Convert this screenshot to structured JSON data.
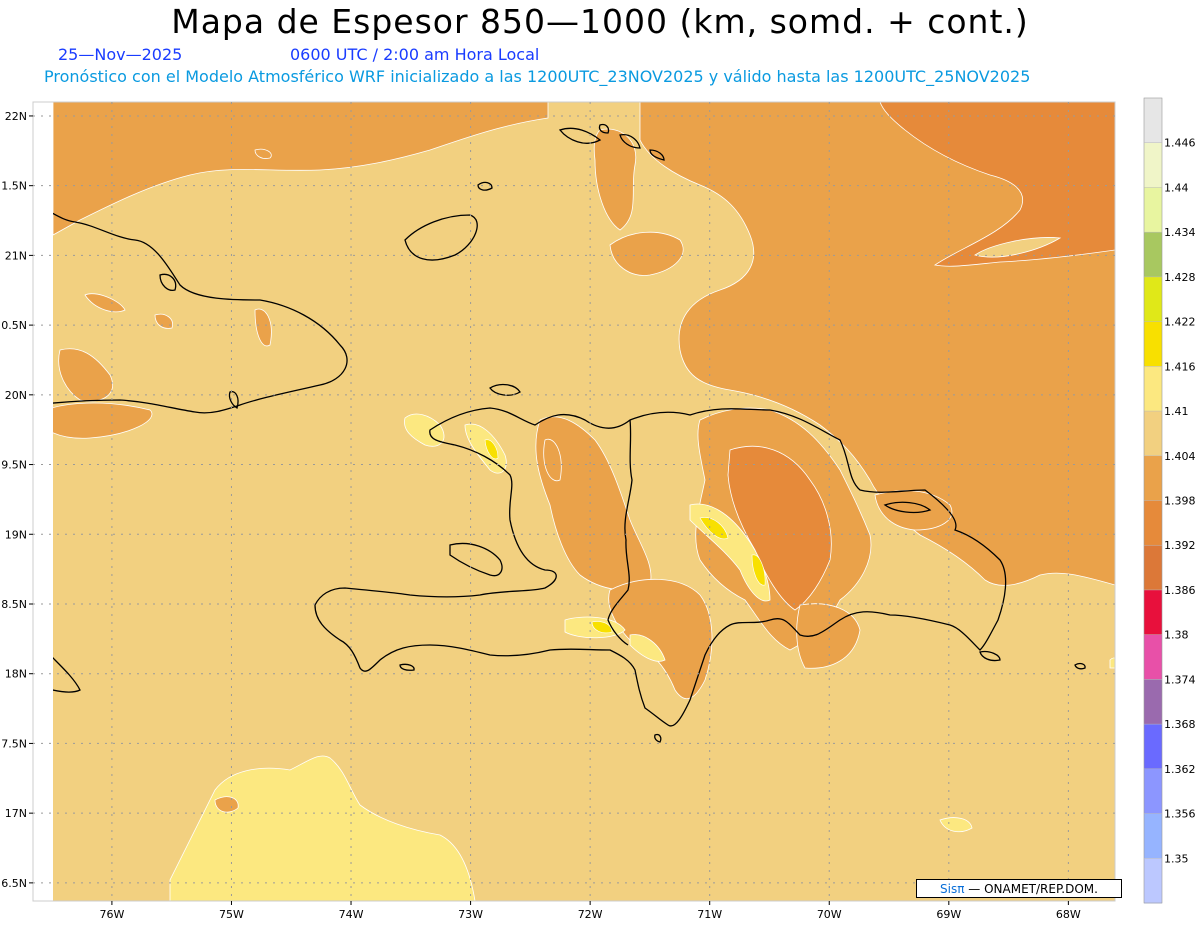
{
  "header": {
    "title": "Mapa de Espesor 850—1000 (km, somd. + cont.)",
    "date": "25—Nov—2025",
    "time": "0600 UTC / 2:00 am Hora Local",
    "model_line": "Pronóstico con el Modelo Atmosférico WRF inicializado a las 1200UTC_23NOV2025 y válido hasta las  1200UTC_25NOV2025"
  },
  "axes": {
    "lat_labels": [
      "22N",
      "1.5N",
      "21N",
      "0.5N",
      "20N",
      "9.5N",
      "19N",
      "8.5N",
      "18N",
      "7.5N",
      "17N",
      "6.5N"
    ],
    "lat_values": [
      22,
      21.5,
      21,
      20.5,
      20,
      19.5,
      19,
      18.5,
      18,
      17.5,
      17,
      16.5
    ],
    "lon_labels": [
      "76W",
      "75W",
      "74W",
      "73W",
      "72W",
      "71W",
      "70W",
      "69W",
      "68W"
    ],
    "lon_values": [
      -76,
      -75,
      -74,
      -73,
      -72,
      -71,
      -70,
      -69,
      -68
    ],
    "lon_range": [
      -76.66,
      -67.61
    ],
    "lat_range": [
      16.37,
      22.1
    ]
  },
  "legend": {
    "labels": [
      "1.446",
      "1.44",
      "1.434",
      "1.428",
      "1.422",
      "1.416",
      "1.41",
      "1.404",
      "1.398",
      "1.392",
      "1.386",
      "1.38",
      "1.374",
      "1.368",
      "1.362",
      "1.356",
      "1.35"
    ],
    "colors": [
      "#e6e6e6",
      "#f0f5c8",
      "#e8f5a0",
      "#a8c860",
      "#e0e818",
      "#f8e000",
      "#fce880",
      "#f2d080",
      "#eaa24a",
      "#e68a3a",
      "#dc7838",
      "#e8103c",
      "#e850a8",
      "#9a6aae",
      "#6a6aff",
      "#8c96ff",
      "#96b4ff",
      "#bcc8ff"
    ]
  },
  "credit": {
    "logo": "Sisπ",
    "text": "— ONAMET/REP.DOM."
  },
  "colors": {
    "field_base": "#f2d080",
    "field_orange": "#eaa24a",
    "field_dark": "#e68a3a",
    "field_yellow": "#fce880",
    "field_bright": "#f8e000",
    "grid": "#9a9a9a",
    "coast": "#000000"
  }
}
